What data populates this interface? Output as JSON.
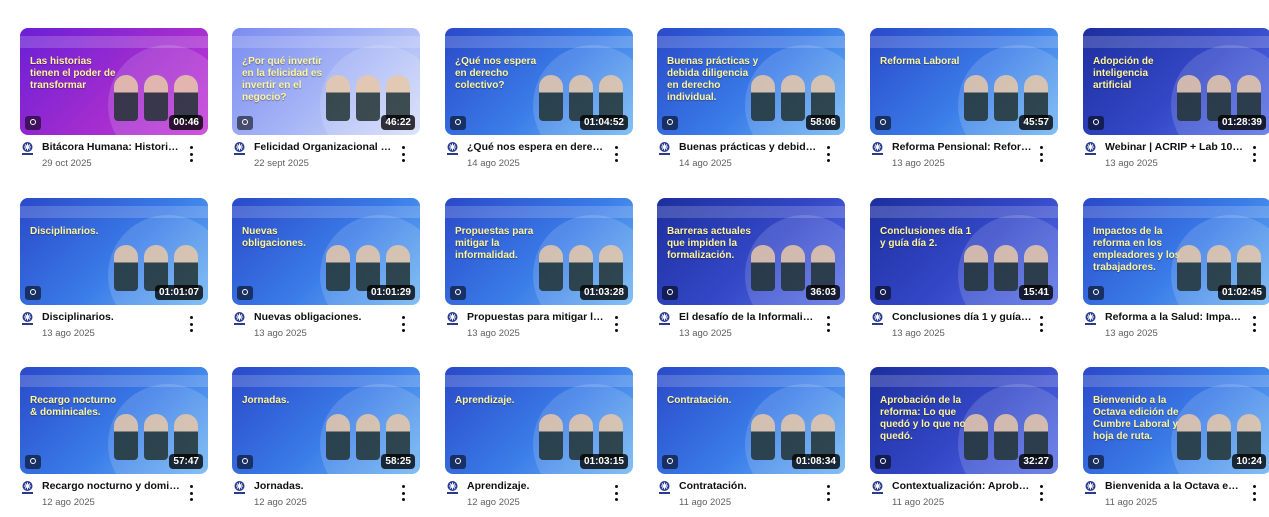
{
  "videos": [
    {
      "title": "Bitácora Humana: Historias...",
      "date": "29 oct 2025",
      "duration": "00:46",
      "thumb_text": "Las historias tienen el poder de transformar",
      "variant": "purple"
    },
    {
      "title": "Felicidad Organizacional 2...",
      "date": "22 sept 2025",
      "duration": "46:22",
      "thumb_text": "¿Por qué invertir en la felicidad es invertir en el negocio?",
      "variant": "light"
    },
    {
      "title": "¿Qué nos espera en derech...",
      "date": "14 ago 2025",
      "duration": "01:04:52",
      "thumb_text": "¿Qué nos espera en derecho colectivo?",
      "variant": "blue"
    },
    {
      "title": "Buenas prácticas y debida ...",
      "date": "14 ago 2025",
      "duration": "58:06",
      "thumb_text": "Buenas prácticas y debida diligencia en derecho individual.",
      "variant": "blue"
    },
    {
      "title": "Reforma Pensional: Reform...",
      "date": "13 ago 2025",
      "duration": "45:57",
      "thumb_text": "Reforma Laboral",
      "variant": "blue"
    },
    {
      "title": "Webinar | ACRIP + Lab 10: ...",
      "date": "13 ago 2025",
      "duration": "01:28:39",
      "thumb_text": "Adopción de inteligencia artificial",
      "variant": "deep"
    },
    {
      "title": "Disciplinarios.",
      "date": "13 ago 2025",
      "duration": "01:01:07",
      "thumb_text": "Disciplinarios.",
      "variant": "blue"
    },
    {
      "title": "Nuevas obligaciones.",
      "date": "13 ago 2025",
      "duration": "01:01:29",
      "thumb_text": "Nuevas obligaciones.",
      "variant": "blue"
    },
    {
      "title": "Propuestas para mitigar la i...",
      "date": "13 ago 2025",
      "duration": "01:03:28",
      "thumb_text": "Propuestas para mitigar la informalidad.",
      "variant": "blue"
    },
    {
      "title": "El desafío de la Informalida...",
      "date": "13 ago 2025",
      "duration": "36:03",
      "thumb_text": "Barreras actuales que impiden la formalización.",
      "variant": "deep"
    },
    {
      "title": "Conclusiones día 1 y guía dí...",
      "date": "13 ago 2025",
      "duration": "15:41",
      "thumb_text": "Conclusiones día 1 y guía día 2.",
      "variant": "deep"
    },
    {
      "title": "Reforma a la Salud: Impact...",
      "date": "13 ago 2025",
      "duration": "01:02:45",
      "thumb_text": "Impactos de la reforma en los empleadores y los trabajadores.",
      "variant": "blue"
    },
    {
      "title": "Recargo nocturno y domini...",
      "date": "12 ago 2025",
      "duration": "57:47",
      "thumb_text": "Recargo nocturno & dominicales.",
      "variant": "blue"
    },
    {
      "title": "Jornadas.",
      "date": "12 ago 2025",
      "duration": "58:25",
      "thumb_text": "Jornadas.",
      "variant": "blue"
    },
    {
      "title": "Aprendizaje.",
      "date": "12 ago 2025",
      "duration": "01:03:15",
      "thumb_text": "Aprendizaje.",
      "variant": "blue"
    },
    {
      "title": "Contratación.",
      "date": "11 ago 2025",
      "duration": "01:08:34",
      "thumb_text": "Contratación.",
      "variant": "blue"
    },
    {
      "title": "Contextualización: Aproba...",
      "date": "11 ago 2025",
      "duration": "32:27",
      "thumb_text": "Aprobación de la reforma: Lo que quedó y lo que no quedó.",
      "variant": "deep"
    },
    {
      "title": "Bienvenida a la Octava edi...",
      "date": "11 ago 2025",
      "duration": "10:24",
      "thumb_text": "Bienvenido a la Octava edición de Cumbre Laboral y hoja de ruta.",
      "variant": "blue"
    }
  ]
}
